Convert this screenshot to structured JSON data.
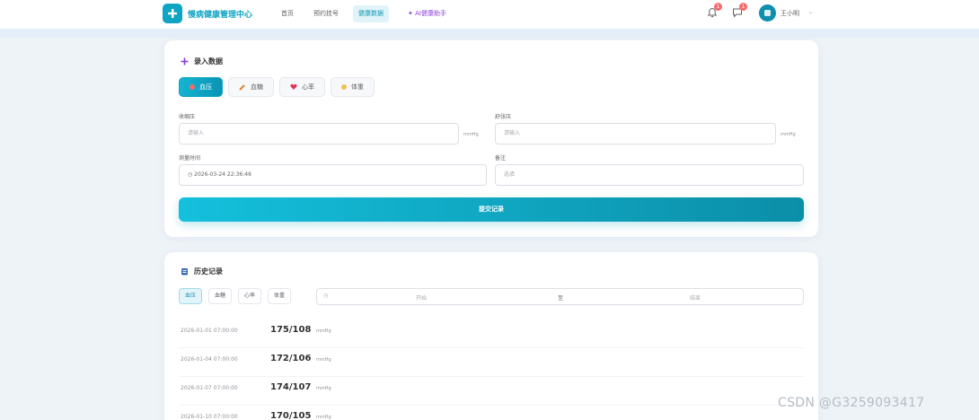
{
  "app": {
    "title": "慢病健康管理中心"
  },
  "nav": {
    "items": [
      {
        "label": "首页",
        "active": false
      },
      {
        "label": "预约挂号",
        "active": false
      },
      {
        "label": "健康数据",
        "active": true
      },
      {
        "label": "AI健康助手",
        "active": false
      }
    ],
    "ai_prefix": "✦"
  },
  "header": {
    "notifications_count": "1",
    "messages_count": "1",
    "username": "王小明",
    "caret": "⌄"
  },
  "entry": {
    "title": "录入数据",
    "title_icon": "plus-icon",
    "types": [
      {
        "label": "血压",
        "icon": "drop-icon",
        "active": true
      },
      {
        "label": "血糖",
        "icon": "syringe-icon",
        "active": false
      },
      {
        "label": "心率",
        "icon": "heart-icon",
        "active": false
      },
      {
        "label": "体重",
        "icon": "scale-icon",
        "active": false
      }
    ],
    "systolic_label": "收缩压",
    "systolic_placeholder": "请输入",
    "systolic_unit": "mmHg",
    "diastolic_label": "舒张压",
    "diastolic_placeholder": "请输入",
    "diastolic_unit": "mmHg",
    "time_label": "测量时间",
    "time_value": "2026-03-24 22:36:46",
    "note_label": "备注",
    "note_placeholder": "选填",
    "submit_label": "提交记录"
  },
  "history": {
    "title": "历史记录",
    "filters": [
      {
        "label": "血压",
        "active": true
      },
      {
        "label": "血糖",
        "active": false
      },
      {
        "label": "心率",
        "active": false
      },
      {
        "label": "体重",
        "active": false
      }
    ],
    "range_start": "开始",
    "range_sep": "至",
    "range_end": "结束",
    "records": [
      {
        "time": "2026-01-01 07:00:00",
        "value": "175/108",
        "unit": "mmHg"
      },
      {
        "time": "2026-01-04 07:00:00",
        "value": "172/106",
        "unit": "mmHg"
      },
      {
        "time": "2026-01-07 07:00:00",
        "value": "174/107",
        "unit": "mmHg"
      },
      {
        "time": "2026-01-10 07:00:00",
        "value": "170/105",
        "unit": "mmHg"
      }
    ]
  },
  "watermark": "CSDN @G3259093417",
  "colors": {
    "accent": "#0ea5c4",
    "accent_dark": "#0b8aa6",
    "ai": "#8b3fd6",
    "badge": "#f56c6c",
    "background": "#eef3f8"
  }
}
